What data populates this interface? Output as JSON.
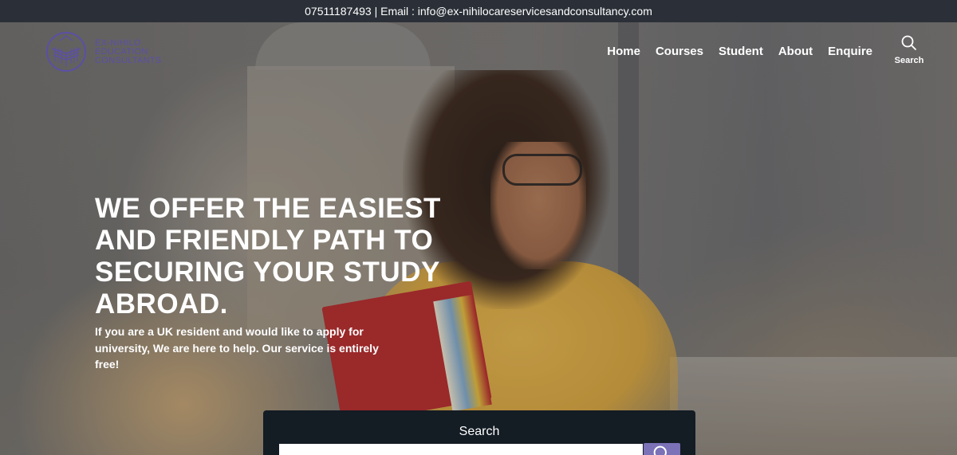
{
  "topbar": {
    "contact": "07511187493 | Email : info@ex-nihilocareservicesandconsultancy.com"
  },
  "logo": {
    "line1": "EX-NIHILO",
    "line2": "EDUCATION",
    "line3": "CONSULTANTS",
    "color": "#5b4fa6"
  },
  "nav": {
    "items": [
      {
        "label": "Home"
      },
      {
        "label": "Courses"
      },
      {
        "label": "Student"
      },
      {
        "label": "About"
      },
      {
        "label": "Enquire"
      }
    ],
    "search_label": "Search",
    "search_icon": "search-icon"
  },
  "hero": {
    "headline": "WE OFFER THE EASIEST AND FRIENDLY PATH TO SECURING YOUR STUDY ABROAD.",
    "subtext": "If you are a UK resident and would like to apply for university, We are here to help. Our service is entirely free!"
  },
  "search_panel": {
    "title": "Search",
    "input_value": "",
    "button_icon": "search-icon",
    "button_color": "#7b72b8"
  }
}
